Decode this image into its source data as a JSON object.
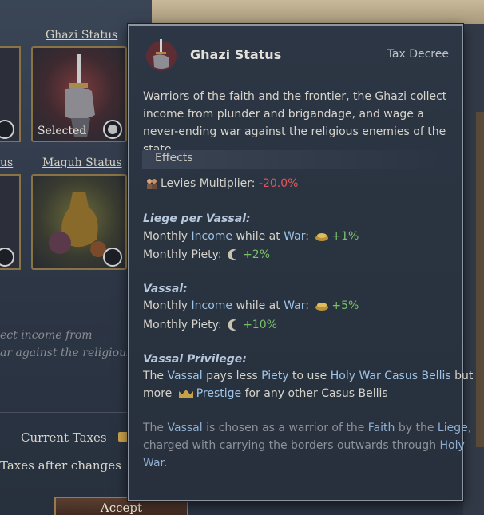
{
  "background": {
    "cards": [
      {
        "title": "Ghazi Status",
        "state": "Selected"
      },
      {
        "title": "Maguh Status"
      }
    ],
    "left_card_titles": [
      "",
      "us"
    ],
    "description_fragment": [
      "ect income from",
      "ar against the religious"
    ],
    "current_taxes_label": "Current Taxes",
    "taxes_after_label": "Taxes after changes",
    "accept_label": "Accept"
  },
  "tooltip": {
    "title": "Ghazi Status",
    "type": "Tax Decree",
    "icon": "ghazi-hand-dagger-icon",
    "description": "Warriors of the faith and the frontier, the Ghazi collect income from plunder and brigandage, and wage a never-ending war against the religious enemies of the state.",
    "effects_label": "Effects",
    "levies": {
      "label": "Levies Multiplier:",
      "value": "-20.0%",
      "icon": "levies-icon"
    },
    "liege": {
      "heading": "Liege per Vassal:",
      "income_pre": "Monthly ",
      "income_word": "Income",
      "income_post": " while at ",
      "war_word": "War",
      "income_value": "+1%",
      "piety_label": "Monthly Piety:",
      "piety_value": "+2%"
    },
    "vassal": {
      "heading": "Vassal:",
      "income_pre": "Monthly ",
      "income_word": "Income",
      "income_post": " while at ",
      "war_word": "War",
      "income_value": "+5%",
      "piety_label": "Monthly Piety:",
      "piety_value": "+10%"
    },
    "privilege": {
      "heading": "Vassal Privilege:",
      "the": "The ",
      "vassal": "Vassal",
      "pays_less": " pays less ",
      "piety": "Piety",
      "to_use": " to use ",
      "holy_war": "Holy War Casus Bellis",
      "but": " but",
      "more": "more ",
      "prestige": "Prestige",
      "rest": " for any other Casus Bellis"
    },
    "flavor": {
      "the": "The ",
      "vassal": "Vassal",
      "mid1": " is chosen as a warrior of the ",
      "faith": "Faith",
      "mid2": " by the ",
      "liege": "Liege",
      "comma": ",",
      "line2": "charged with carrying the borders outwards through ",
      "holy": "Holy",
      "war": "War",
      "end": "."
    },
    "colors": {
      "negative": "#e0575a",
      "positive": "#7ac06a",
      "link": "#9fc3e6"
    }
  }
}
